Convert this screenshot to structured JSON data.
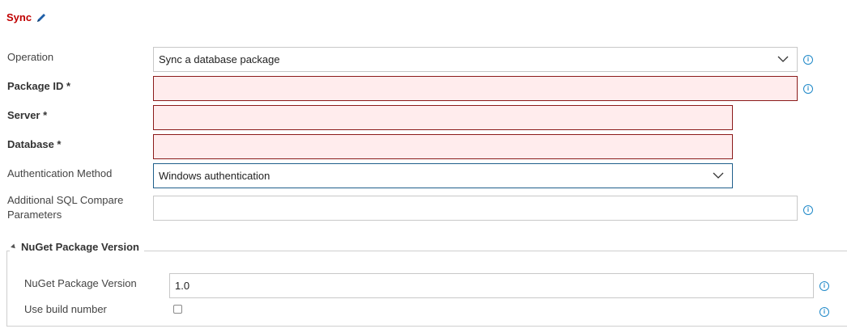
{
  "header": {
    "title": "Sync",
    "edit_icon": "pencil-icon"
  },
  "form": {
    "operation": {
      "label": "Operation",
      "value": "Sync a database package"
    },
    "package_id": {
      "label": "Package ID *",
      "value": ""
    },
    "server": {
      "label": "Server *",
      "value": ""
    },
    "database": {
      "label": "Database *",
      "value": ""
    },
    "auth_method": {
      "label": "Authentication Method",
      "value": "Windows authentication"
    },
    "additional_params": {
      "label_line1": "Additional SQL Compare",
      "label_line2": "Parameters",
      "value": ""
    }
  },
  "nuget_group": {
    "legend": "NuGet Package Version",
    "version": {
      "label": "NuGet Package Version",
      "value": "1.0"
    },
    "use_build_number": {
      "label": "Use build number",
      "checked": false
    }
  },
  "info_icon": "i",
  "colors": {
    "title": "#c00000",
    "invalid_bg": "#ffeced",
    "invalid_border": "#8b1a1a",
    "info": "#1e88c8"
  }
}
